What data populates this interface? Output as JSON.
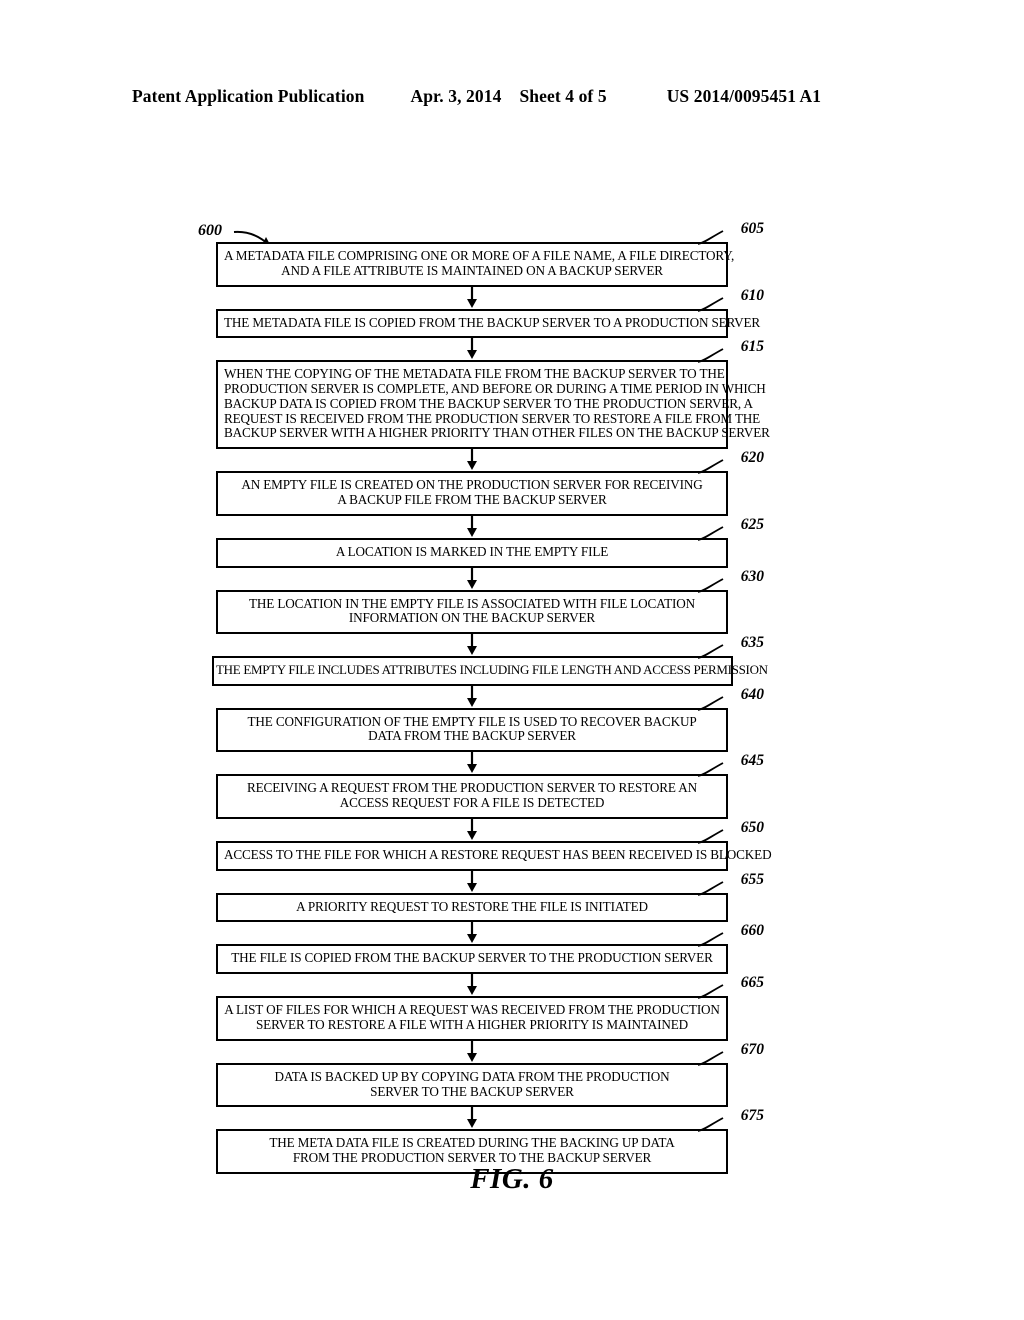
{
  "header": {
    "publication": "Patent Application Publication",
    "date": "Apr. 3, 2014",
    "sheet": "Sheet 4 of 5",
    "patent_number": "US 2014/0095451 A1"
  },
  "figure": {
    "label": "FIG. 6",
    "diagram_number": "600"
  },
  "flowchart": {
    "steps": [
      {
        "ref": "605",
        "lines": [
          "A METADATA FILE COMPRISING ONE OR MORE OF A FILE NAME, A FILE DIRECTORY,",
          "AND A FILE ATTRIBUTE IS MAINTAINED ON A BACKUP SERVER"
        ]
      },
      {
        "ref": "610",
        "lines": [
          "THE METADATA FILE IS COPIED FROM THE BACKUP SERVER TO A PRODUCTION SERVER"
        ]
      },
      {
        "ref": "615",
        "lines": [
          "WHEN THE COPYING OF THE METADATA FILE FROM THE BACKUP SERVER TO THE",
          "PRODUCTION SERVER IS COMPLETE, AND BEFORE OR DURING A TIME PERIOD IN WHICH",
          "BACKUP DATA IS COPIED FROM THE BACKUP SERVER TO THE PRODUCTION SERVER, A",
          "REQUEST IS RECEIVED FROM THE PRODUCTION SERVER TO RESTORE A FILE FROM THE",
          "BACKUP SERVER WITH A HIGHER PRIORITY THAN OTHER FILES ON THE BACKUP SERVER"
        ]
      },
      {
        "ref": "620",
        "lines": [
          "AN EMPTY FILE IS CREATED ON THE PRODUCTION SERVER FOR RECEIVING",
          "A BACKUP FILE FROM THE BACKUP SERVER"
        ]
      },
      {
        "ref": "625",
        "lines": [
          "A LOCATION IS MARKED IN THE EMPTY FILE"
        ]
      },
      {
        "ref": "630",
        "lines": [
          "THE LOCATION IN THE EMPTY FILE IS ASSOCIATED WITH FILE LOCATION",
          "INFORMATION ON THE BACKUP SERVER"
        ]
      },
      {
        "ref": "635",
        "lines": [
          "THE EMPTY FILE INCLUDES ATTRIBUTES INCLUDING FILE LENGTH AND ACCESS PERMISSION"
        ]
      },
      {
        "ref": "640",
        "lines": [
          "THE CONFIGURATION OF THE EMPTY FILE IS USED TO RECOVER BACKUP",
          "DATA FROM THE BACKUP SERVER"
        ]
      },
      {
        "ref": "645",
        "lines": [
          "RECEIVING A REQUEST FROM THE PRODUCTION SERVER TO RESTORE AN",
          "ACCESS REQUEST FOR A FILE IS DETECTED"
        ]
      },
      {
        "ref": "650",
        "lines": [
          "ACCESS TO THE FILE FOR WHICH A RESTORE REQUEST HAS BEEN RECEIVED IS BLOCKED"
        ]
      },
      {
        "ref": "655",
        "lines": [
          "A PRIORITY REQUEST TO RESTORE THE FILE IS INITIATED"
        ]
      },
      {
        "ref": "660",
        "lines": [
          "THE FILE IS COPIED FROM THE BACKUP SERVER TO THE PRODUCTION SERVER"
        ]
      },
      {
        "ref": "665",
        "lines": [
          "A LIST OF FILES FOR WHICH A REQUEST WAS RECEIVED FROM THE PRODUCTION",
          "SERVER TO RESTORE A FILE WITH A HIGHER PRIORITY IS MAINTAINED"
        ]
      },
      {
        "ref": "670",
        "lines": [
          "DATA IS BACKED UP BY COPYING DATA FROM THE PRODUCTION",
          "SERVER TO THE BACKUP SERVER"
        ]
      },
      {
        "ref": "675",
        "lines": [
          "THE META DATA FILE IS CREATED DURING THE BACKING UP DATA",
          "FROM THE PRODUCTION SERVER TO THE BACKUP SERVER"
        ]
      }
    ]
  }
}
